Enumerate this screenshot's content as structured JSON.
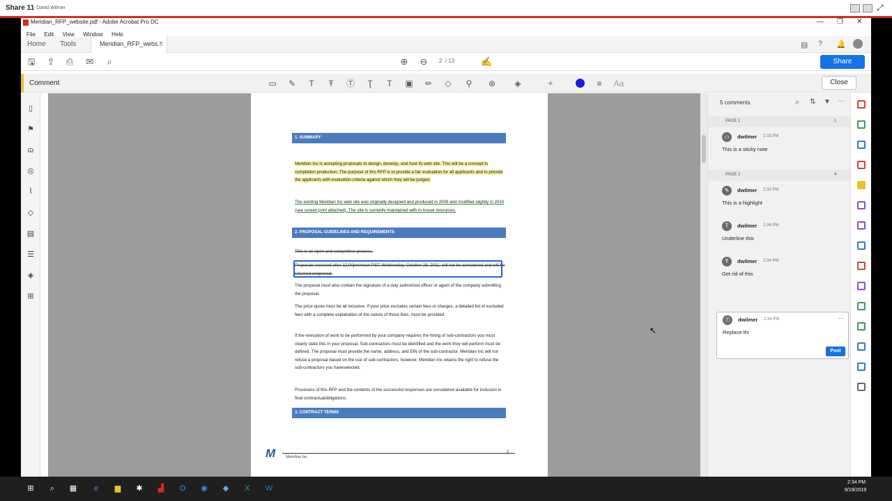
{
  "share_bar": {
    "title": "Share 11",
    "presenter": "- David Wilmer"
  },
  "window": {
    "title": "Meridian_RFP_website.pdf - Adobe Acrobat Pro DC",
    "menu": [
      "File",
      "Edit",
      "View",
      "Window",
      "Help"
    ]
  },
  "tabs": {
    "home": "Home",
    "tools": "Tools",
    "doc": "Meridian_RFP_webs...",
    "close": "×"
  },
  "toolbar": {
    "page_current": "2",
    "page_total": "/ 13",
    "share_label": "Share"
  },
  "comment_bar": {
    "label": "Comment",
    "close_label": "Close",
    "text_props": "Aa",
    "accent": "#e8c12c"
  },
  "document": {
    "section1": "1. SUMMARY",
    "para1": "Meridian Inc is accepting proposals to design, develop, and host its web site. This will be a concept to completion production. The purpose of this RFP is to provide a fair evaluation for all applicants and to provide the applicants with evaluation criteria against which they will be judged.",
    "para2": "The existing Meridian Inc web site was originally designed and produced in 2009 and modified slightly in 2010 (see screen print attached). The site is currently maintained with in-house resources.",
    "section2": "2. PROPOSAL GUIDELINES AND REQUIREMENTS",
    "para3": "This is an open and competitive process.",
    "para4": "Proposals received after 12:00pm/noon PST, Wednesday, October 28, 2011, will not be considered and will be returned unopened.",
    "para5": "The proposal must also contain the signature of a duly authorized officer or agent of the company submitting the proposal.",
    "para6": "The price quote must be all inclusive. If your price excludes certain fees or charges, a detailed list of excluded fees with a complete explanation of the nature of those fees, must be provided.",
    "para7": "If the execution of work to be performed by your company requires the hiring of sub-contractors you must clearly state this in your proposal. Sub-contractors must be identified and the work they will perform must be defined. The proposal must provide the name, address, and EIN of the sub-contractor. Meridian Inc will not refuse a proposal based on the use of sub-contractors; however, Meridian Inc retains the right to refuse the sub-contractors you haveselected.",
    "para8": "Provisions of this RFP and the contents of the successful responses are considered available for inclusion in final contractualobligations.",
    "section3": "3. CONTRACT TERMS",
    "footer_logo": "M",
    "footer_company": "Meridian Inc",
    "footer_page": "2"
  },
  "comments_panel": {
    "header": "5 comments",
    "page1": {
      "label": "PAGE 1",
      "count": "1"
    },
    "page2": {
      "label": "PAGE 2",
      "count": "4"
    },
    "items": [
      {
        "author": "dwilmer",
        "time": "2:33 PM",
        "text": "This is a sticky note"
      },
      {
        "author": "dwilmer",
        "time": "2:33 PM",
        "text": "This is a highlight"
      },
      {
        "author": "dwilmer",
        "time": "2:34 PM",
        "text": "Underline this"
      },
      {
        "author": "dwilmer",
        "time": "2:34 PM",
        "text": "Get rid of this"
      },
      {
        "author": "dwilmer",
        "time": "2:34 PM",
        "text": "Replace thi"
      }
    ],
    "post_label": "Post"
  },
  "taskbar": {
    "time": "2:34 PM",
    "date": "9/19/2019"
  },
  "colors": {
    "accent_blue": "#1473e6",
    "section_blue": "#4b7bbf",
    "highlight": "#f6ef9b",
    "share_red": "#d32b1e"
  }
}
